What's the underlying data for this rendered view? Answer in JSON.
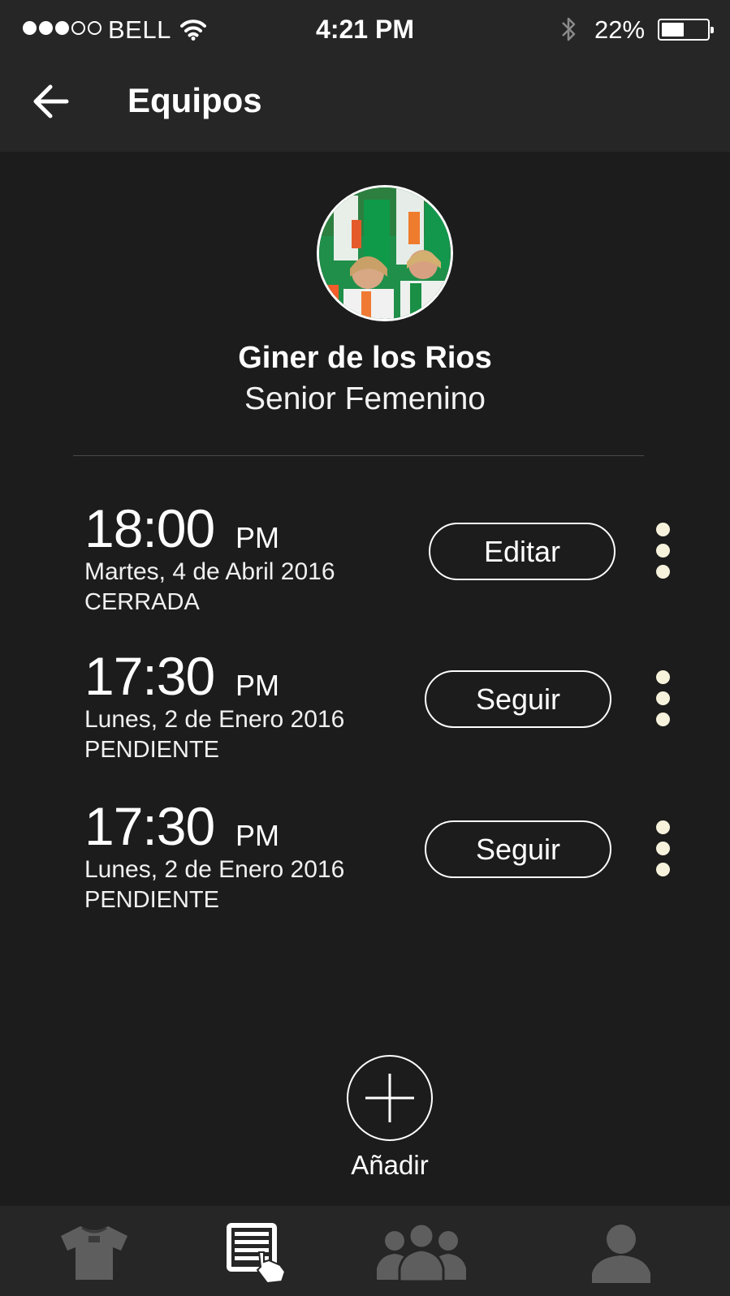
{
  "status_bar": {
    "carrier": "BELL",
    "time": "4:21 PM",
    "battery": "22%",
    "battery_level": 0.22,
    "signal_bars_filled": 3,
    "signal_bars_total": 5
  },
  "header": {
    "title": "Equipos",
    "back_icon": "arrow-left-icon"
  },
  "team": {
    "name": "Giner de los Rios",
    "category": "Senior Femenino",
    "avatar_icon": "team-photo"
  },
  "events": [
    {
      "time": "18:00",
      "ampm": "PM",
      "date": "Martes, 4 de Abril 2016",
      "status": "CERRADA",
      "action": "Editar"
    },
    {
      "time": "17:30",
      "ampm": "PM",
      "date": "Lunes, 2 de Enero 2016",
      "status": "PENDIENTE",
      "action": "Seguir"
    },
    {
      "time": "17:30",
      "ampm": "PM",
      "date": "Lunes, 2 de Enero 2016",
      "status": "PENDIENTE",
      "action": "Seguir"
    }
  ],
  "add": {
    "label": "Añadir",
    "icon": "plus-icon"
  },
  "tabbar": {
    "tabs": [
      {
        "icon": "jersey-icon",
        "active": false
      },
      {
        "icon": "list-touch-icon",
        "active": true
      },
      {
        "icon": "group-icon",
        "active": false
      },
      {
        "icon": "user-icon",
        "active": false
      }
    ]
  },
  "colors": {
    "background": "#1c1c1c",
    "bar": "#262626",
    "text": "#ffffff",
    "more_dots": "#f7f2dc",
    "tab_inactive": "#5e5e5e"
  }
}
